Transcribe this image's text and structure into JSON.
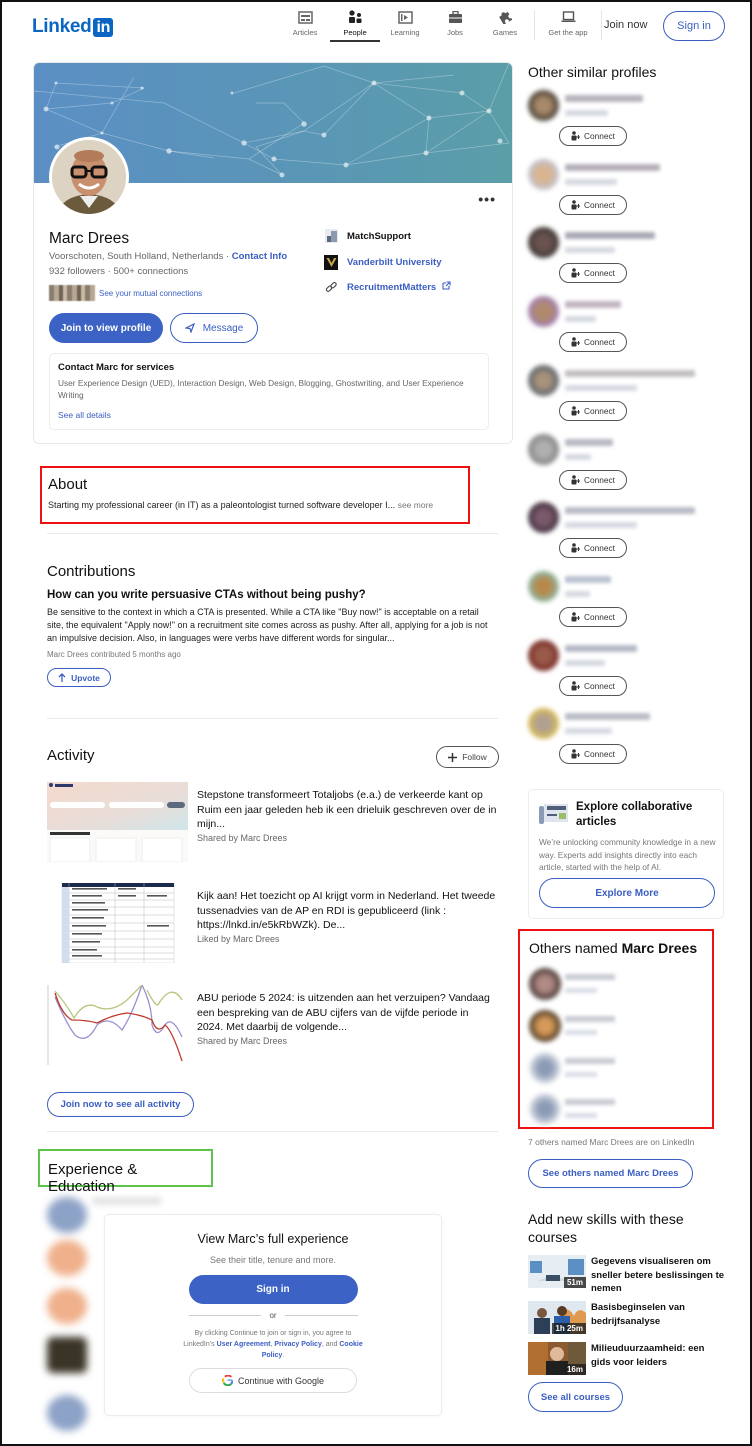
{
  "header": {
    "logo_text": "Linked",
    "logo_badge": "in",
    "nav": [
      {
        "label": "Articles",
        "icon": "articles-icon",
        "active": false
      },
      {
        "label": "People",
        "icon": "people-icon",
        "active": true
      },
      {
        "label": "Learning",
        "icon": "learning-icon",
        "active": false
      },
      {
        "label": "Jobs",
        "icon": "briefcase-icon",
        "active": false
      },
      {
        "label": "Games",
        "icon": "puzzle-icon",
        "active": false
      },
      {
        "label": "Get the app",
        "icon": "laptop-icon",
        "active": false
      }
    ],
    "join_now": "Join now",
    "sign_in": "Sign in"
  },
  "profile": {
    "name": "Marc Drees",
    "location": "Voorschoten, South Holland, Netherlands",
    "contact_info": "Contact Info",
    "followers": "932 followers",
    "connections": "500+ connections",
    "mutual_link": "See your mutual connections",
    "join_button": "Join to view profile",
    "message_button": "Message",
    "affiliations": [
      {
        "label": "MatchSupport",
        "icon": "company-logo-icon",
        "is_link": false
      },
      {
        "label": "Vanderbilt University",
        "icon": "university-logo-icon",
        "is_link": true
      },
      {
        "label": "RecruitmentMatters",
        "icon": "link-icon",
        "is_link": true,
        "external": true
      }
    ],
    "services": {
      "title": "Contact Marc for services",
      "list": "User Experience Design (UED), Interaction Design, Web Design, Blogging, Ghostwriting, and User Experience Writing",
      "link": "See all details"
    }
  },
  "about": {
    "title": "About",
    "text": "Starting my professional career (in IT) as a paleontologist turned software developer I...",
    "see_more": "see more"
  },
  "contributions": {
    "title": "Contributions",
    "question": "How can you write persuasive CTAs without being pushy?",
    "body": "Be sensitive to the context in which a CTA is presented. While a CTA like \"Buy now!\" is acceptable on a retail site, the equivalent \"Apply now!\" on a recruitment site comes across as pushy. After all, applying for a job is not an impulsive decision. Also, in languages were verbs have different words for singular...",
    "meta": "Marc Drees contributed 5 months ago",
    "upvote": "Upvote"
  },
  "activity": {
    "title": "Activity",
    "follow": "Follow",
    "items": [
      {
        "title": "Stepstone transformeert Totaljobs (e.a.) de verkeerde kant op Ruim een jaar geleden heb ik een drieluik geschreven over de in mijn...",
        "meta": "Shared by Marc Drees",
        "thumb": "website-screenshot"
      },
      {
        "title": "Kijk aan! Het toezicht op AI krijgt vorm in Nederland. Het tweede tussenadvies van de AP en RDI is gepubliceerd (link : https://lnkd.in/e5kRbWZk). De...",
        "meta": "Liked by Marc Drees",
        "thumb": "table-document"
      },
      {
        "title": "ABU periode 5 2024: is uitzenden aan het verzuipen? Vandaag een bespreking van de ABU cijfers van de vijfde periode in 2024. Met daarbij de volgende...",
        "meta": "Shared by Marc Drees",
        "thumb": "line-chart"
      }
    ],
    "see_all": "Join now to see all activity"
  },
  "experience": {
    "title": "Experience & Education",
    "gate_title": "View Marc’s full experience",
    "gate_sub": "See their title, tenure and more.",
    "sign_in": "Sign in",
    "or": "or",
    "legal_prefix": "By clicking Continue to join or sign in, you agree to LinkedIn’s",
    "user_agreement": "User Agreement",
    "privacy_policy": "Privacy Policy",
    "and": ", and",
    "cookie_policy": "Cookie Policy",
    "google": "Continue with Google"
  },
  "sidebar": {
    "similar_title": "Other similar profiles",
    "connect_label": "Connect",
    "similar_count": 10,
    "explore": {
      "title": "Explore collaborative articles",
      "text": "We’re unlocking community knowledge in a new way. Experts add insights directly into each article, started with the help of AI.",
      "button": "Explore More"
    },
    "others": {
      "title_prefix": "Others named",
      "title_name": "Marc Drees",
      "count_text": "7 others named Marc Drees are on LinkedIn",
      "button_prefix": "See others named",
      "button_name": "Marc Drees"
    },
    "courses": {
      "title": "Add new skills with these courses",
      "items": [
        {
          "title": "Gegevens visualiseren om sneller betere beslissingen te nemen",
          "duration": "51m"
        },
        {
          "title": "Basisbeginselen van bedrijfsanalyse",
          "duration": "1h 25m"
        },
        {
          "title": "Milieuduurzaamheid: een gids voor leiders",
          "duration": "16m"
        }
      ],
      "see_all": "See all courses"
    }
  },
  "colors": {
    "brand": "#0a66c2",
    "button_primary": "#3b62c4",
    "link": "#3b5ec2",
    "highlight_red": "#ee1111",
    "highlight_green": "#5cc44a"
  }
}
